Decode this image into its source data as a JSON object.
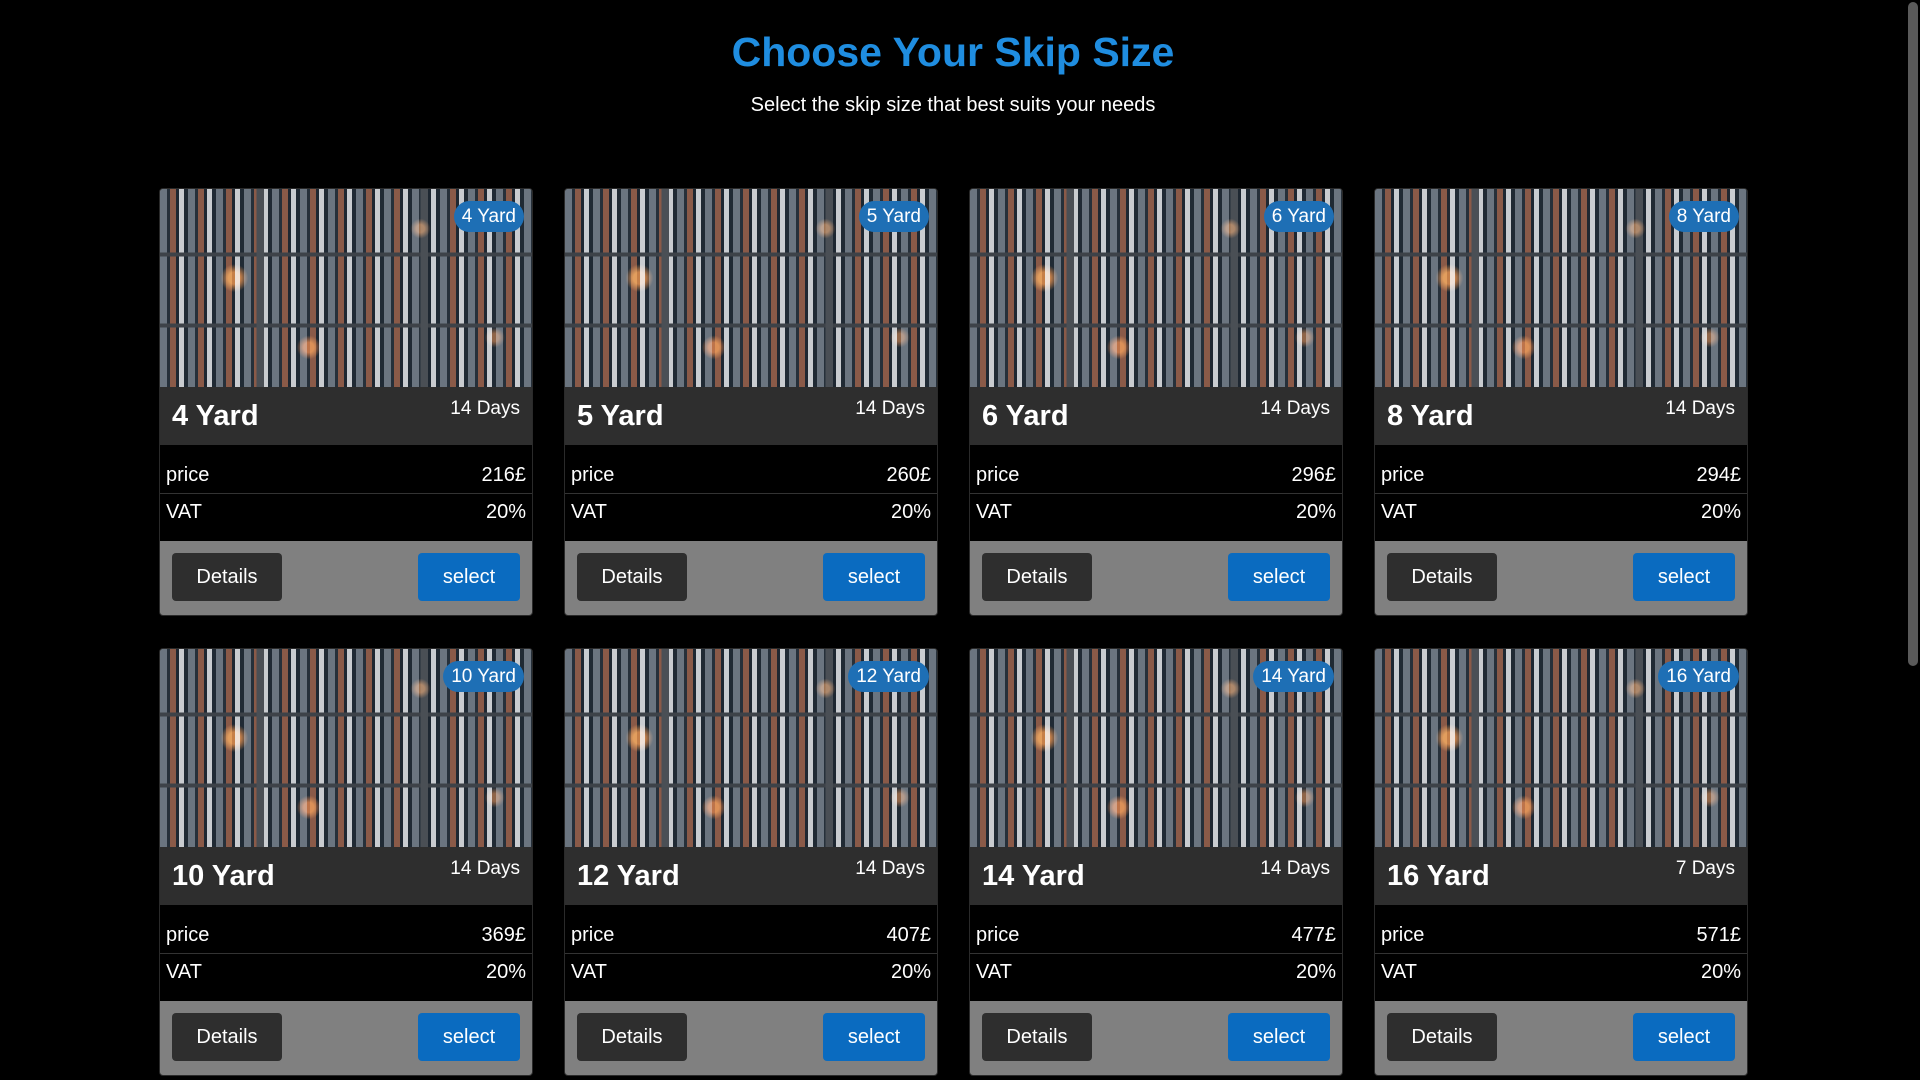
{
  "header": {
    "title": "Choose Your Skip Size",
    "subtitle": "Select the skip size that best suits your needs"
  },
  "labels": {
    "price": "price",
    "vat": "VAT",
    "details": "Details",
    "select": "select"
  },
  "colors": {
    "title": "#1f8de0",
    "badge": "#1e6fb5",
    "select_button": "#0a6bc0",
    "details_button": "#2e2e2e",
    "card_footer": "#808080",
    "page_background": "#000000"
  },
  "skips": [
    {
      "badge": "4 Yard",
      "name": "4 Yard",
      "days": "14 Days",
      "price": "216£",
      "vat": "20%"
    },
    {
      "badge": "5 Yard",
      "name": "5 Yard",
      "days": "14 Days",
      "price": "260£",
      "vat": "20%"
    },
    {
      "badge": "6 Yard",
      "name": "6 Yard",
      "days": "14 Days",
      "price": "296£",
      "vat": "20%"
    },
    {
      "badge": "8 Yard",
      "name": "8 Yard",
      "days": "14 Days",
      "price": "294£",
      "vat": "20%"
    },
    {
      "badge": "10 Yard",
      "name": "10 Yard",
      "days": "14 Days",
      "price": "369£",
      "vat": "20%"
    },
    {
      "badge": "12 Yard",
      "name": "12 Yard",
      "days": "14 Days",
      "price": "407£",
      "vat": "20%"
    },
    {
      "badge": "14 Yard",
      "name": "14 Yard",
      "days": "14 Days",
      "price": "477£",
      "vat": "20%"
    },
    {
      "badge": "16 Yard",
      "name": "16 Yard",
      "days": "7 Days",
      "price": "571£",
      "vat": "20%"
    }
  ]
}
